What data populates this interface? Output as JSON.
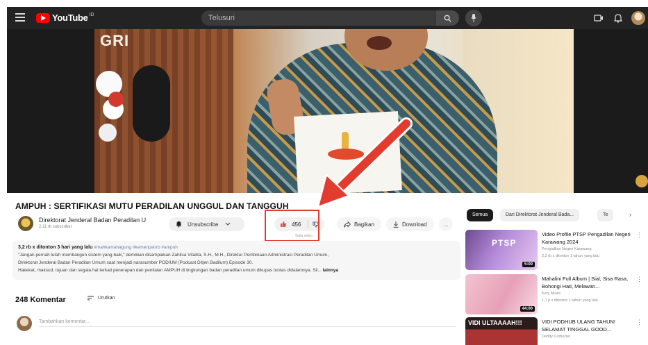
{
  "topbar": {
    "logo_text": "YouTube",
    "logo_sup": "ID",
    "search_placeholder": "Telusuri"
  },
  "video": {
    "overlay_text": "GRI"
  },
  "watch": {
    "title": "AMPUH : SERTIFIKASI MUTU PERADILAN UNGGUL DAN TANGGUH",
    "channel_name": "Direktorat Jenderal Badan Peradilan U",
    "channel_subs": "2,11 rb subscriber",
    "unsubscribe_label": "Unsubscribe",
    "like_count": "456",
    "like_sub": "Suka video",
    "share_label": "Bagikan",
    "download_label": "Download",
    "more_label": "..."
  },
  "description": {
    "meta": "3,2 rb x ditonton  3 hari yang lalu",
    "tags": "#mahkamahagung #kemenpanrb #ampuh",
    "line2": "\"Jangan pernah lelah membangun sistem yang baik,\" demikian disampaikan Zahlisa Vitalita, S.H., M.H., Direktur Pembinaan Administrasi Peradilan Umum,",
    "line3": "Direktorat Jenderal Badan Peradilan Umum saat menjadi narasumber PODIUM (Podcast Ditjen Badilum) Episode 30.",
    "line4": "Hakekat, maksud, tujuan dan segala hal terkait penerapan dan penilaian AMPUH di lingkungan badan peradilan umum dikupas tuntas didalamnya. Sil...",
    "more": "lainnya"
  },
  "comments": {
    "count_label": "248 Komentar",
    "sort_label": "Urutkan",
    "add_placeholder": "Tambahkan komentar..."
  },
  "chips": {
    "all": "Semua",
    "from_channel": "Dari Direktorat Jenderal Bada...",
    "third": "Te"
  },
  "recommendations": [
    {
      "title": "Video Profile PTSP Pengadilan Negeri Karawang 2024",
      "channel": "Pengadilan Negeri Karawang",
      "meta": "2,2 rb x ditonton  1 tahun yang lalu",
      "duration": "5:00",
      "thumb_word": "PTSP"
    },
    {
      "title": "Mahalini Full Album | Sial, Sisa Rasa, Bohongi Hati, Melawan...",
      "channel": "Kery Music",
      "meta": "1,1 jt x ditonton  1 tahun yang lalu",
      "duration": "44:00",
      "thumb_word": ""
    },
    {
      "title": "VIDI PODHUB ULANG TAHUN! SELAMAT TINGGAL GOOD...",
      "channel": "Deddy Corbuzier",
      "meta": "",
      "duration": "",
      "thumb_word": "VIDI ULTAAAAH!!!"
    }
  ],
  "colors": {
    "accent_red": "#e33b2e",
    "brand_red": "#ff0000",
    "topbar_bg": "#232323"
  }
}
